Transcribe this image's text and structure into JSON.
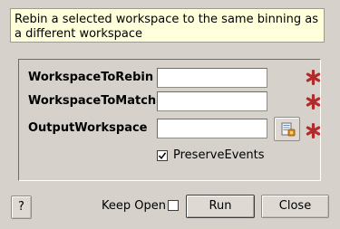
{
  "description": "Rebin a selected workspace to the same binning as a different workspace",
  "properties": [
    {
      "label": "WorkspaceToRebin",
      "value": "",
      "required": true
    },
    {
      "label": "WorkspaceToMatch",
      "value": "",
      "required": true
    },
    {
      "label": "OutputWorkspace",
      "value": "",
      "required": true
    }
  ],
  "preserve_events": {
    "label": "PreserveEvents",
    "checked": true
  },
  "footer": {
    "help_label": "?",
    "keep_open_label": "Keep Open",
    "keep_open_checked": false,
    "run_label": "Run",
    "close_label": "Close"
  },
  "colors": {
    "required_star": "#b22a2a",
    "background": "#d6d2cb",
    "description_bg": "#ffffdc"
  },
  "icons": {
    "required": "asterisk-icon",
    "browse": "browse-workspace-icon",
    "check": "checkmark-icon"
  }
}
